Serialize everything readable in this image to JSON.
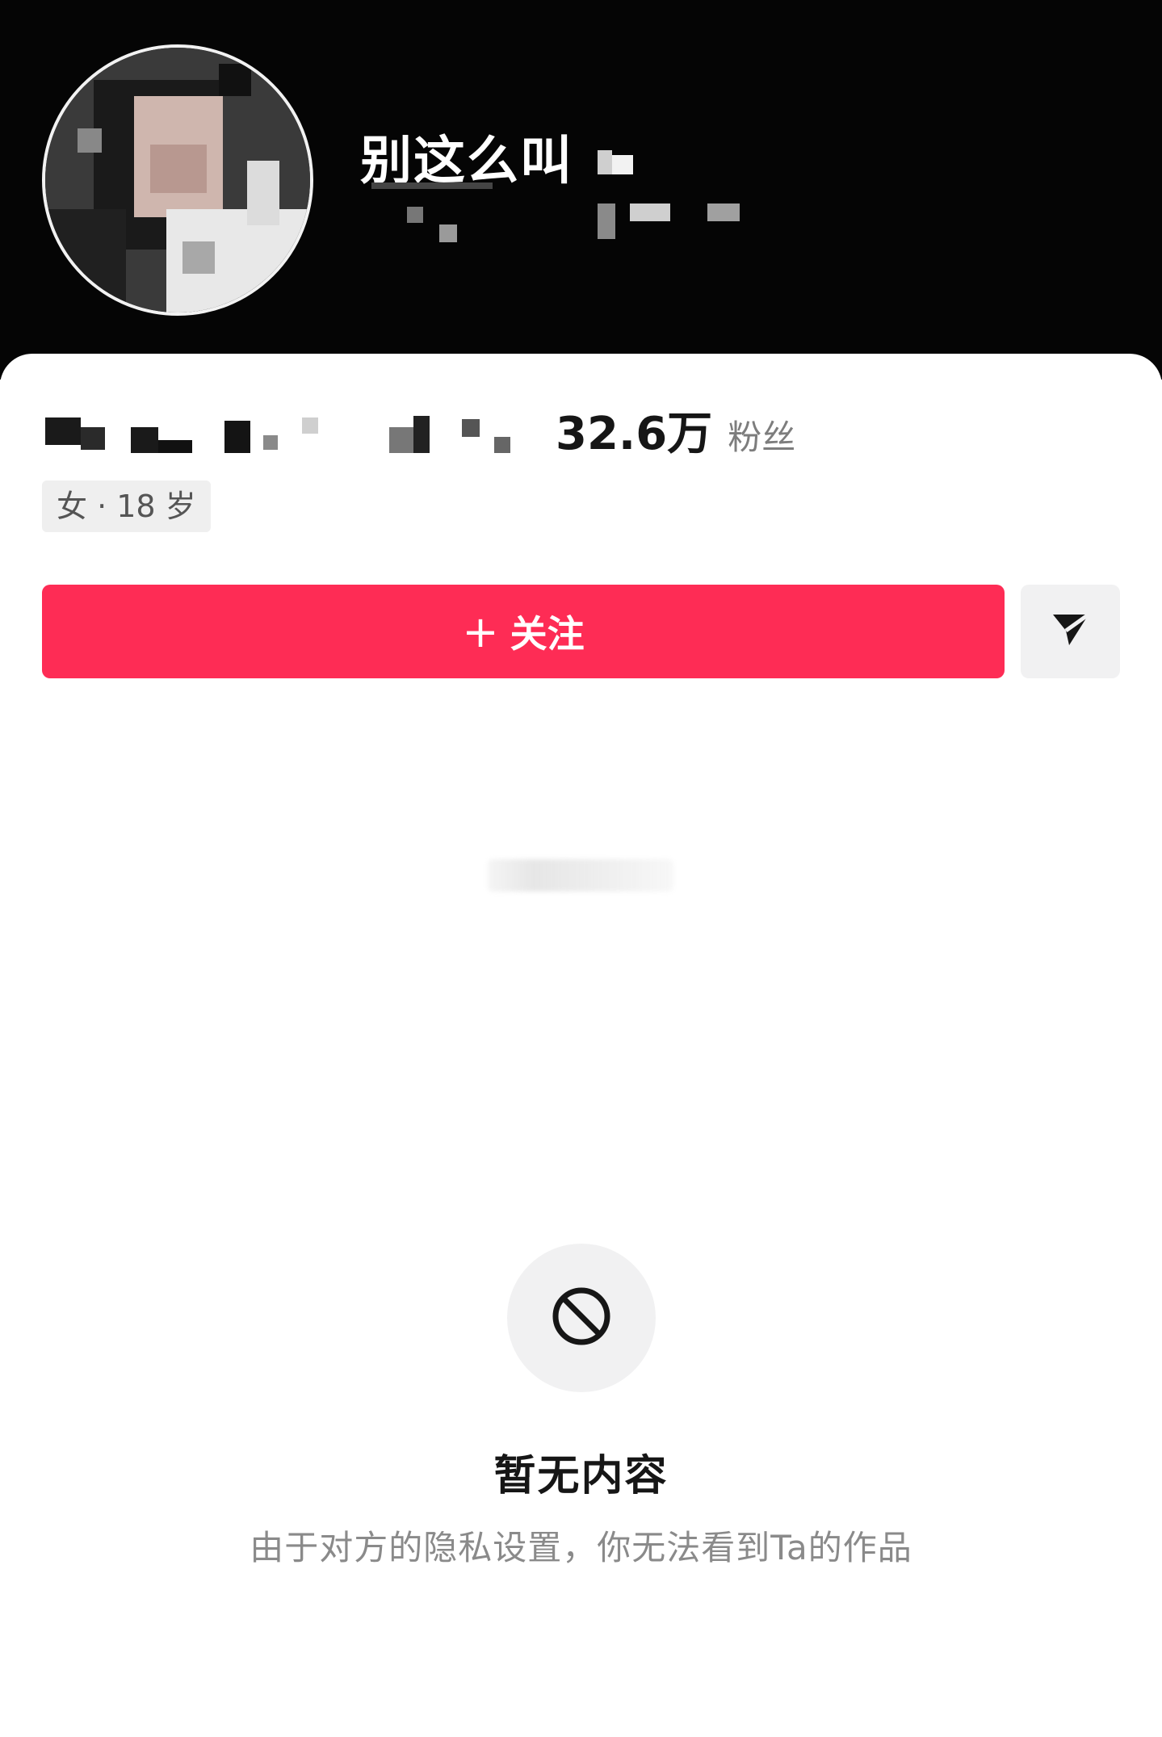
{
  "header": {
    "username": "别这么叫"
  },
  "profile": {
    "followers_count": "32.6万",
    "followers_label": "粉丝",
    "tag": "女 · 18 岁"
  },
  "actions": {
    "follow_plus": "+",
    "follow_label": "关注",
    "share_icon": "send-icon"
  },
  "empty_state": {
    "icon": "forbidden-icon",
    "title": "暂无内容",
    "description": "由于对方的隐私设置，你无法看到Ta的作品"
  },
  "colors": {
    "header_bg": "#050505",
    "follow_button": "#fe2c55",
    "secondary_button": "#f1f1f2"
  }
}
